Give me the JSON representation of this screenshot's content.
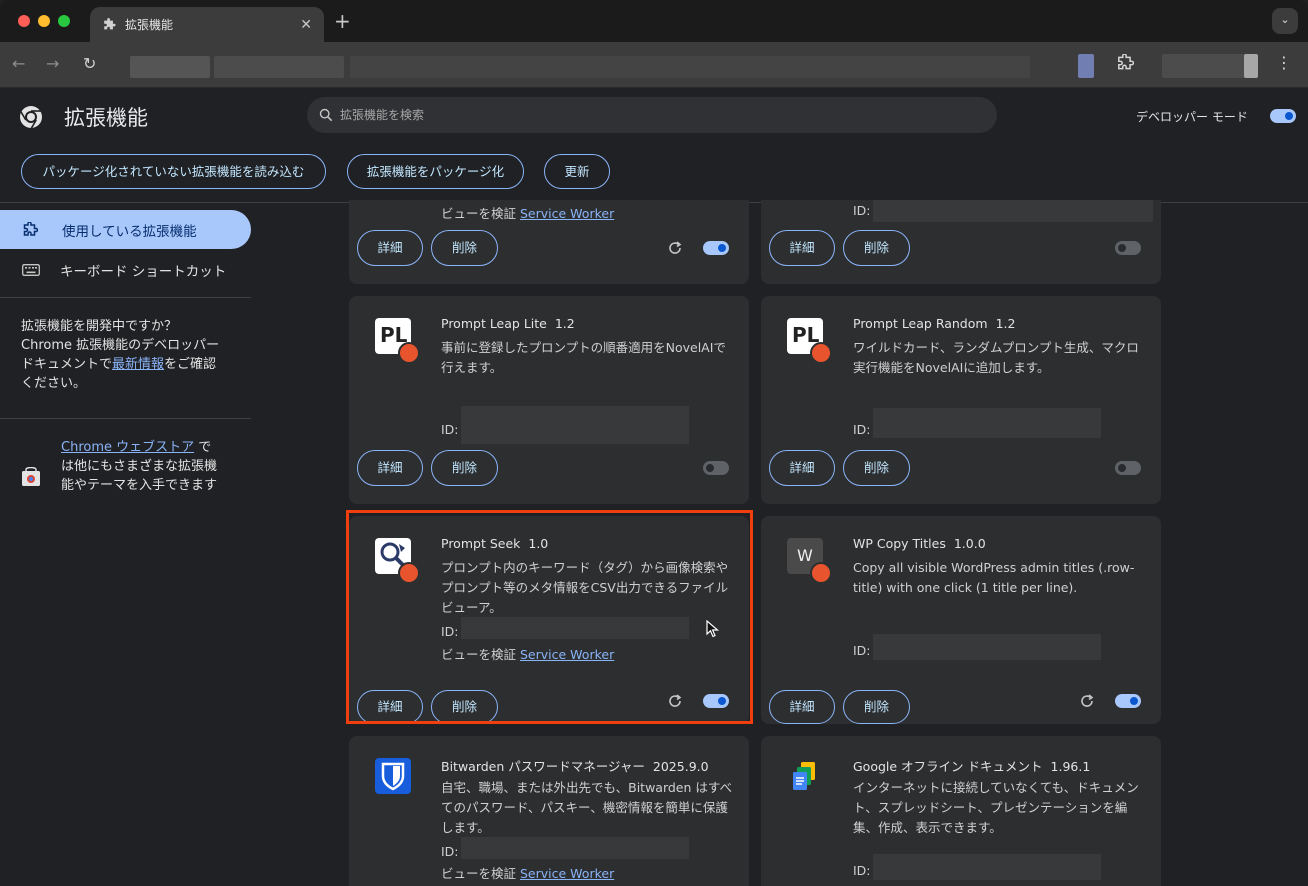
{
  "browser": {
    "tab_title": "拡張機能",
    "new_tab": "+",
    "tab_close": "✕",
    "tab_menu": "⌄",
    "nav": {
      "back": "←",
      "forward": "→",
      "reload": "↻",
      "menu": "⋮"
    }
  },
  "header": {
    "title": "拡張機能",
    "search_placeholder": "拡張機能を検索",
    "devmode_label": "デベロッパー モード",
    "devmode_on": true
  },
  "actions": {
    "load_unpacked": "パッケージ化されていない拡張機能を読み込む",
    "pack": "拡張機能をパッケージ化",
    "update": "更新"
  },
  "sidebar": {
    "items": [
      {
        "label": "使用している拡張機能",
        "icon": "puzzle-icon",
        "active": true
      },
      {
        "label": "キーボード ショートカット",
        "icon": "keyboard-icon",
        "active": false
      }
    ],
    "dev_text_pre": "拡張機能を開発中ですか？ Chrome 拡張機能のデベロッパー ドキュメントで",
    "dev_link": "最新情報",
    "dev_text_post": "をご確認ください。",
    "store_link": "Chrome ウェブストア",
    "store_text": " では他にもさまざまな拡張機能やテーマを入手できます"
  },
  "common": {
    "details": "詳細",
    "remove": "削除",
    "id_label": "ID:",
    "inspect_views": "ビューを検証",
    "service_worker": "Service Worker"
  },
  "cards": [
    {
      "name": "Prompt Leap Lite",
      "version": "1.2",
      "desc": "事前に登録したプロンプトの順番適用をNovelAIで行えます。",
      "icon_text": "PL",
      "enabled": false
    },
    {
      "name": "Prompt Leap Random",
      "version": "1.2",
      "desc": "ワイルドカード、ランダムプロンプト生成、マクロ実行機能をNovelAIに追加します。",
      "icon_text": "PL",
      "enabled": false
    },
    {
      "name": "Prompt Seek",
      "version": "1.0",
      "desc": "プロンプト内のキーワード（タグ）から画像検索やプロンプト等のメタ情報をCSV出力できるファイルビューア。",
      "enabled": true
    },
    {
      "name": "WP Copy Titles",
      "version": "1.0.0",
      "desc": "Copy all visible WordPress admin titles (.row-title) with one click (1 title per line).",
      "icon_text": "W",
      "enabled": true
    },
    {
      "name": "Bitwarden パスワードマネージャー",
      "version": "2025.9.0",
      "desc": "自宅、職場、または外出先でも、Bitwarden はすべてのパスワード、パスキー、機密情報を簡単に保護します。"
    },
    {
      "name": "Google オフライン ドキュメント",
      "version": "1.96.1",
      "desc": "インターネットに接続していなくても、ドキュメント、スプレッドシート、プレゼンテーションを編集、作成、表示できます。"
    }
  ],
  "colors": {
    "accent": "#8ab4f8",
    "active_nav": "#a8c7fa",
    "highlight": "#f03e0e",
    "badge": "#e8542e"
  }
}
